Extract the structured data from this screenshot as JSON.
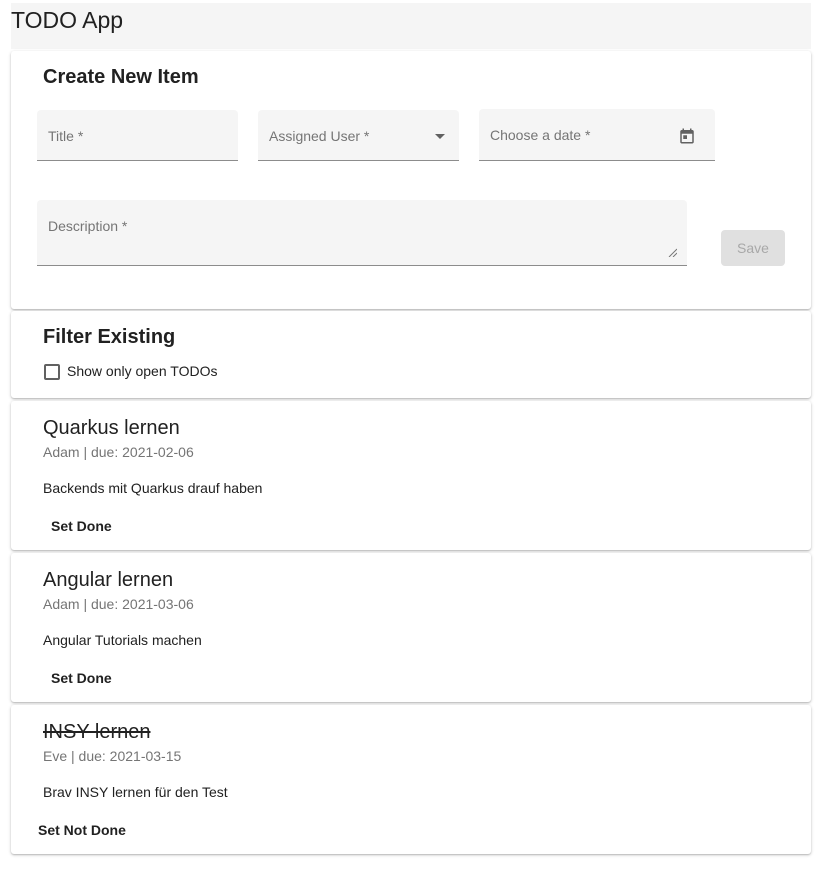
{
  "app": {
    "title": "TODO App"
  },
  "create_form": {
    "heading": "Create New Item",
    "title_label": "Title *",
    "assigned_user_label": "Assigned User *",
    "date_label": "Choose a date *",
    "description_label": "Description *",
    "save_label": "Save",
    "icons": {
      "select": "chevron-down-icon",
      "date": "calendar-icon",
      "resize": "resize-handle-icon"
    }
  },
  "filter": {
    "heading": "Filter Existing",
    "checkbox_label": "Show only open TODOs",
    "checked": false
  },
  "todos": [
    {
      "title": "Quarkus lernen",
      "meta": "Adam | due: 2021-02-06",
      "description": "Backends mit Quarkus drauf haben",
      "action_label": "Set Done",
      "done": false
    },
    {
      "title": "Angular lernen",
      "meta": "Adam | due: 2021-03-06",
      "description": "Angular Tutorials machen",
      "action_label": "Set Done",
      "done": false
    },
    {
      "title": "INSY lernen",
      "meta": "Eve | due: 2021-03-15",
      "description": "Brav INSY lernen für den Test",
      "action_label": "Set Not Done",
      "done": true
    }
  ],
  "colors": {
    "toolbar_bg": "#f5f5f5",
    "field_bg": "#f5f5f5",
    "disabled_button_bg": "#e0e0e0",
    "secondary_text": "#757575"
  }
}
